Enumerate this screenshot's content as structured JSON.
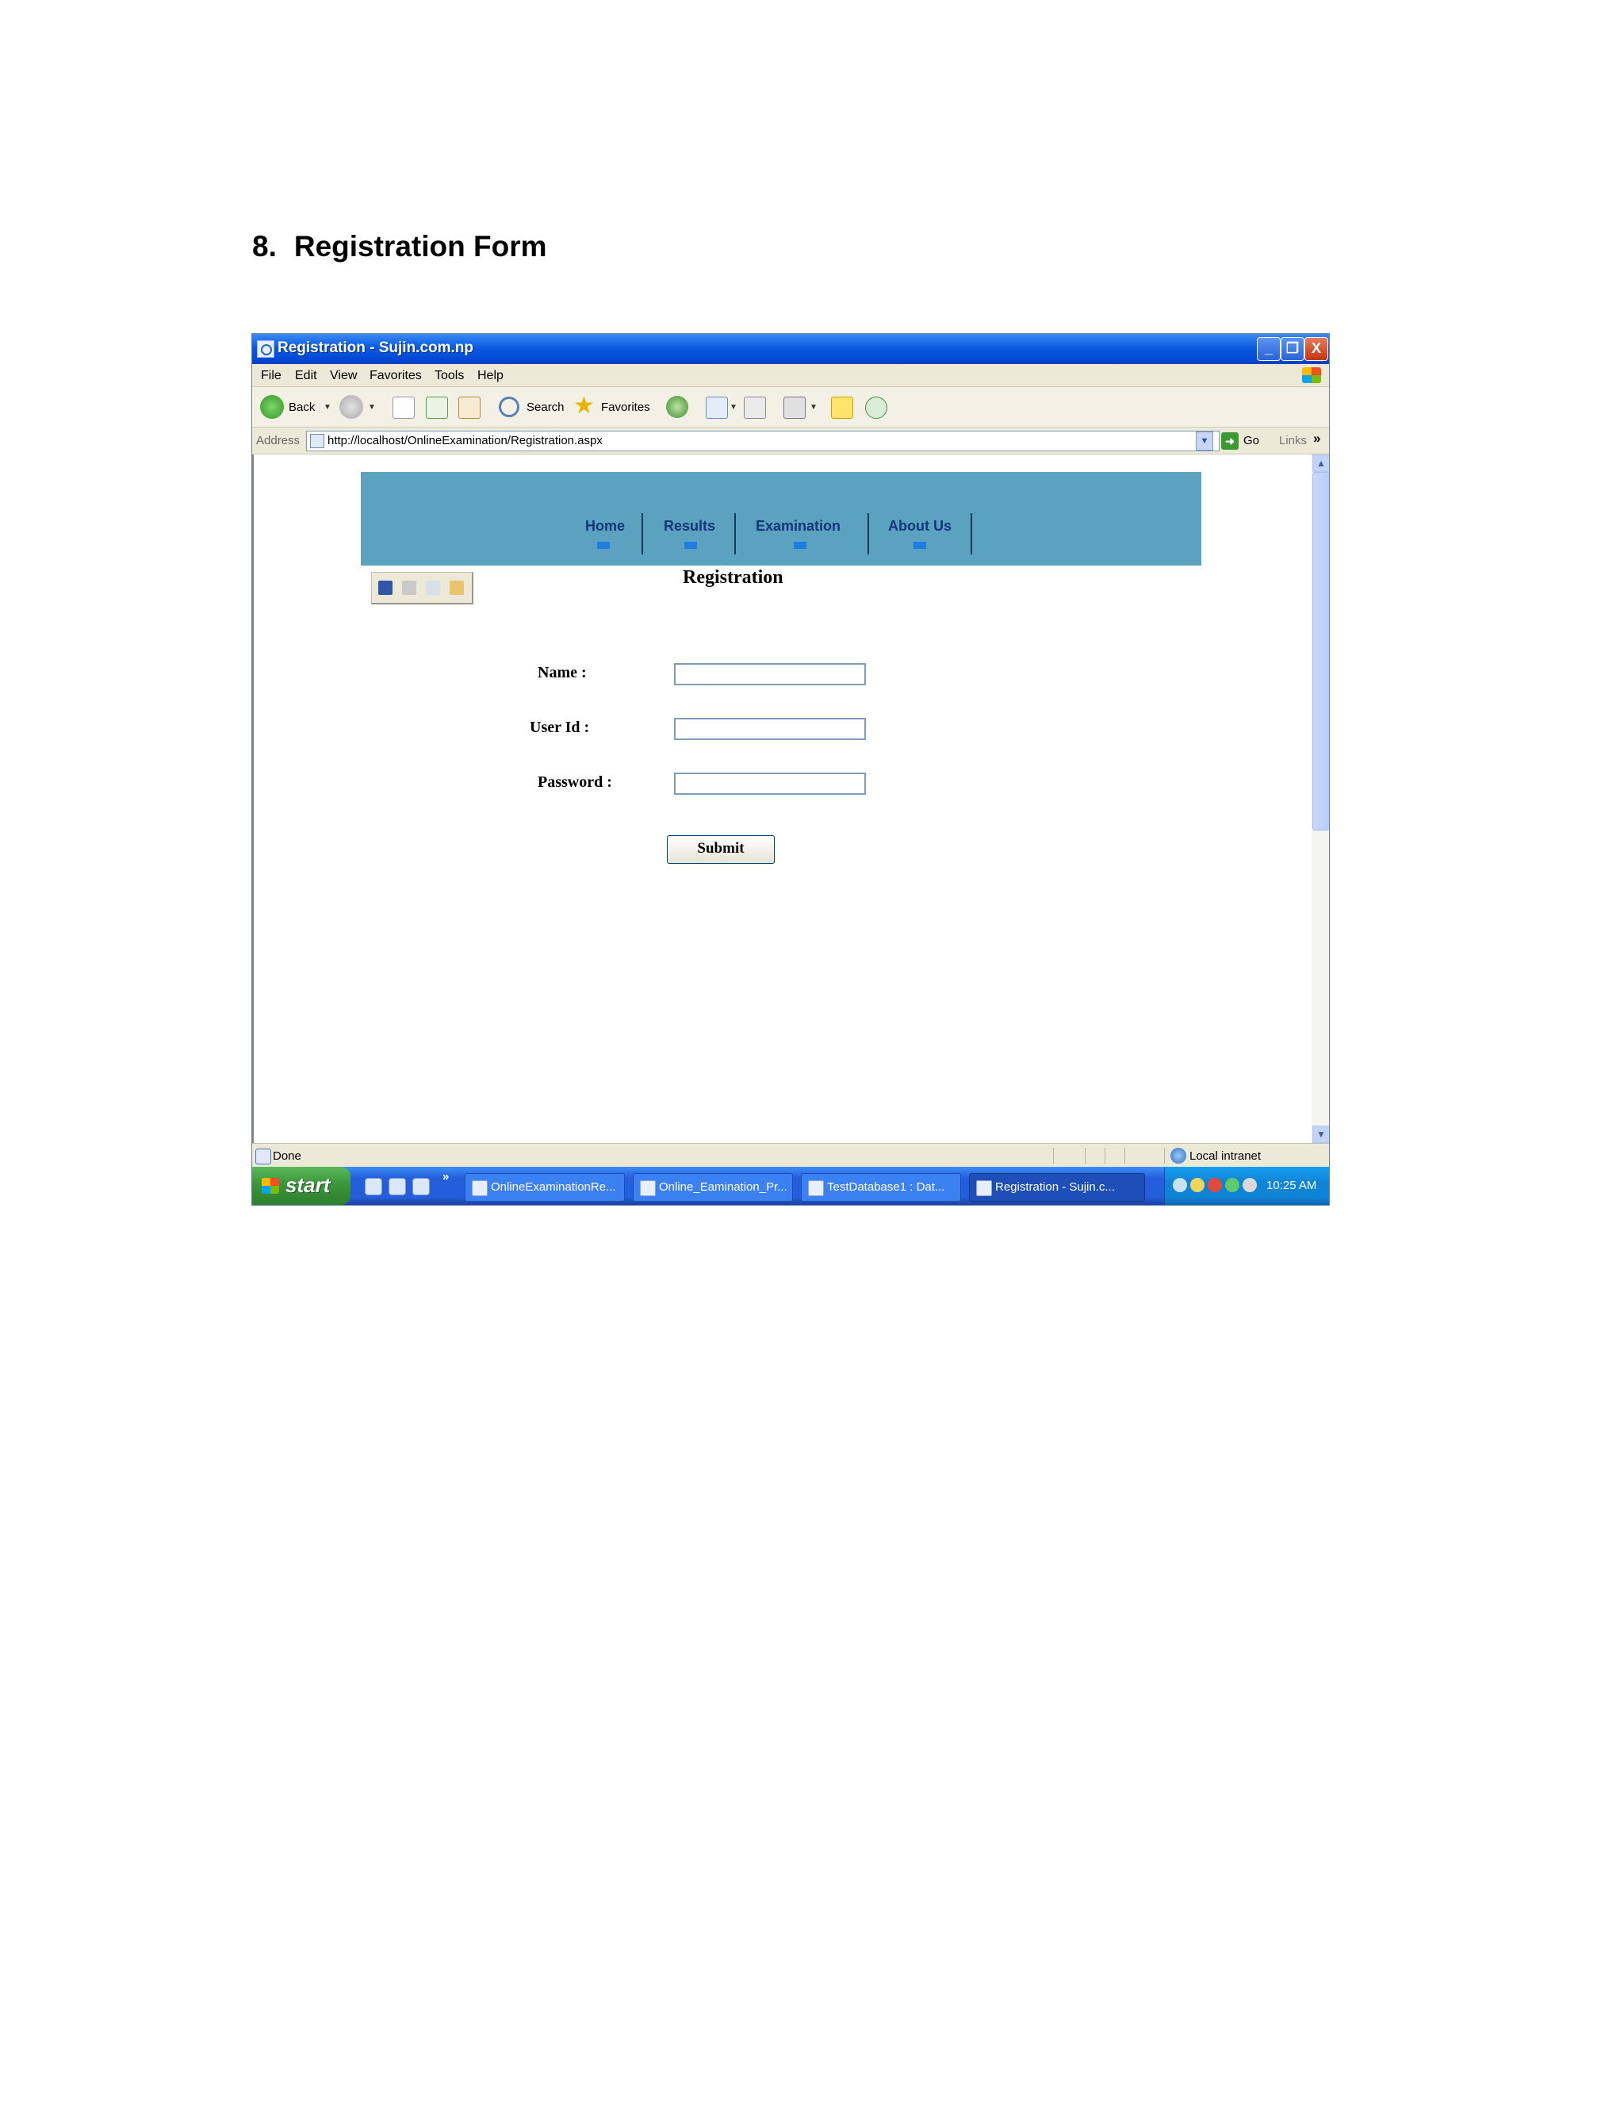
{
  "document": {
    "heading_number": "8.",
    "heading_text": "Registration Form"
  },
  "window": {
    "title": "Registration - Sujin.com.np",
    "min_glyph": "_",
    "max_glyph": "❐",
    "close_glyph": "X"
  },
  "menu": {
    "items": [
      "File",
      "Edit",
      "View",
      "Favorites",
      "Tools",
      "Help"
    ]
  },
  "toolbar": {
    "back_label": "Back",
    "search_label": "Search",
    "favorites_label": "Favorites"
  },
  "address": {
    "label": "Address",
    "url": "http://localhost/OnlineExamination/Registration.aspx",
    "go_label": "Go",
    "links_label": "Links",
    "links_more": "»"
  },
  "site": {
    "header_color": "#5aa2bf",
    "nav": [
      "Home",
      "Results",
      "Examination",
      "About Us"
    ]
  },
  "form": {
    "title": "Registration",
    "name_label": "Name :",
    "name_value": "",
    "userid_label": "User Id :",
    "userid_value": "",
    "password_label": "Password :",
    "password_value": "",
    "submit_label": "Submit"
  },
  "status": {
    "text": "Done",
    "zone": "Local intranet"
  },
  "taskbar": {
    "start_label": "start",
    "ql_more": "»",
    "tasks": [
      "OnlineExaminationRe...",
      "Online_Eamination_Pr...",
      "TestDatabase1 : Dat...",
      "Registration - Sujin.c..."
    ],
    "clock": "10:25 AM"
  }
}
